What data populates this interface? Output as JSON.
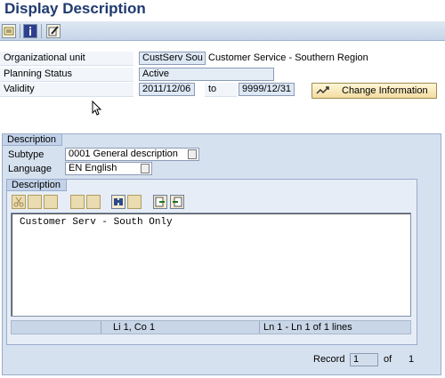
{
  "window": {
    "title": "Display Description"
  },
  "toolbar": {
    "buttons": [
      {
        "icon": "other-object-icon"
      },
      {
        "icon": "info-icon"
      },
      {
        "icon": "edit-pencil-icon"
      }
    ]
  },
  "header": {
    "org_unit_label": "Organizational unit",
    "org_unit_value": "CustServ Sou",
    "org_unit_name": "Customer Service - Southern Region",
    "planning_status_label": "Planning Status",
    "planning_status_value": "Active",
    "validity_label": "Validity",
    "validity_from": "2011/12/06",
    "to_label": "to",
    "validity_to": "9999/12/31",
    "change_button_label": "Change Information"
  },
  "description_group": {
    "tab_label": "Description",
    "subtype_label": "Subtype",
    "subtype_value": "0001 General description",
    "language_label": "Language",
    "language_value": "EN English"
  },
  "editor": {
    "tab_label": "Description",
    "text": "Customer Serv - South Only",
    "status_position": "Li 1, Co 1",
    "status_lines": "Ln 1 - Ln 1 of 1 lines"
  },
  "footer": {
    "record_label": "Record",
    "record_value": "1",
    "of_label": "of",
    "total": "1"
  },
  "colors": {
    "title": "#1f3a70",
    "group_bg": "#d6e1ef",
    "button_bg": "#f3dca0"
  }
}
